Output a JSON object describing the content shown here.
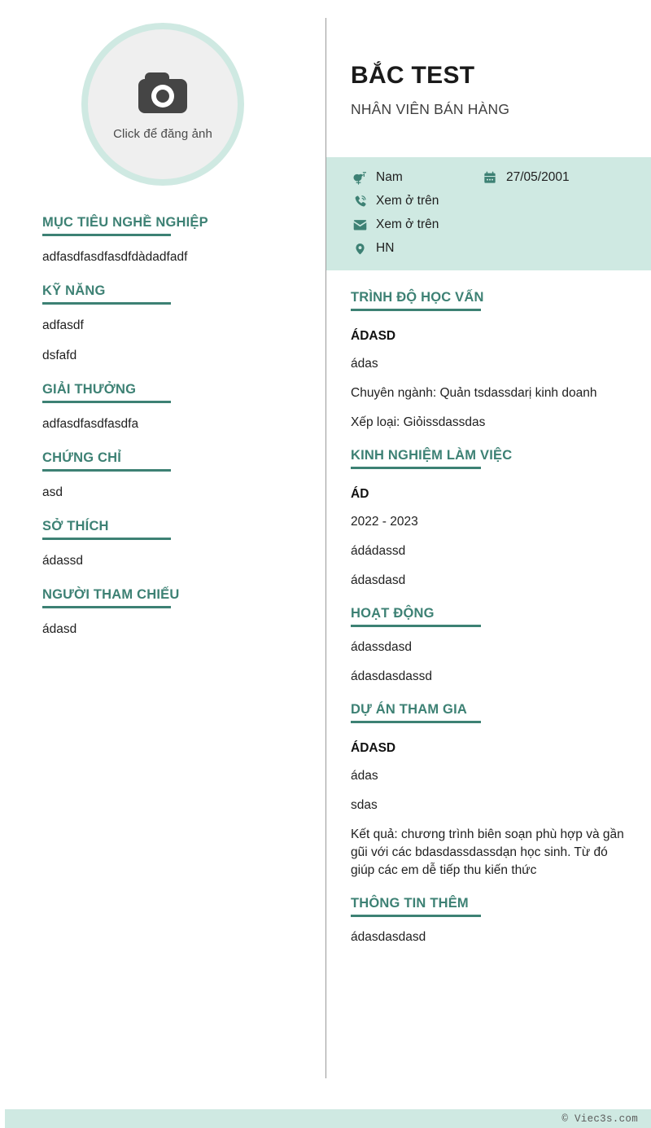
{
  "colors": {
    "accent": "#3d8174",
    "panel_bg": "#cfe9e2",
    "photo_ring": "#cfe9e2",
    "photo_fill": "#efefef",
    "text": "#1f1f1f",
    "divider": "#9a9a9a"
  },
  "photo": {
    "icon": "camera-icon",
    "caption": "Click để đăng ảnh"
  },
  "header": {
    "name": "BẮC TEST",
    "job_title": "NHÂN VIÊN BÁN HÀNG"
  },
  "contact": {
    "gender": {
      "icon": "gender-icon",
      "value": "Nam"
    },
    "birthday": {
      "icon": "calendar-icon",
      "value": "27/05/2001"
    },
    "phone": {
      "icon": "phone-icon",
      "value": "Xem ở trên"
    },
    "email": {
      "icon": "envelope-icon",
      "value": "Xem ở trên"
    },
    "location": {
      "icon": "location-pin-icon",
      "value": "HN"
    }
  },
  "left_sections": [
    {
      "heading": "MỤC TIÊU NGHỀ NGHIỆP",
      "lines": [
        "adfasdfasdfasdfdàdadfadf"
      ]
    },
    {
      "heading": "KỸ NĂNG",
      "lines": [
        "adfasdf",
        "dsfafd"
      ]
    },
    {
      "heading": "GIẢI THƯỞNG",
      "lines": [
        "adfasdfasdfasdfa"
      ]
    },
    {
      "heading": "CHỨNG CHỈ",
      "lines": [
        "asd"
      ]
    },
    {
      "heading": "SỞ THÍCH",
      "lines": [
        "ádassd"
      ]
    },
    {
      "heading": "NGƯỜI THAM CHIẾU",
      "lines": [
        "ádasd"
      ]
    }
  ],
  "right_sections": [
    {
      "heading": "TRÌNH ĐỘ HỌC VẤN",
      "entry_title": "ÁDASD",
      "lines": [
        "ádas",
        "Chuyên ngành: Quản tsdassdarị kinh doanh",
        "Xếp loại: Giỏissdassdas"
      ]
    },
    {
      "heading": "KINH NGHIỆM LÀM VIỆC",
      "entry_title": "ÁD",
      "lines": [
        "2022 - 2023",
        "ádádassd",
        "ádasdasd"
      ]
    },
    {
      "heading": "HOẠT ĐỘNG",
      "entry_title": "",
      "lines": [
        "ádassdasd",
        "ádasdasdassd"
      ]
    },
    {
      "heading": "DỰ ÁN THAM GIA",
      "entry_title": "ÁDASD",
      "lines": [
        "ádas",
        "sdas",
        "Kết quả: chương trình biên soạn phù hợp và gần gũi với các bdasdassdassdạn học sinh. Từ đó giúp các em dễ tiếp thu kiến thức"
      ]
    },
    {
      "heading": "THÔNG TIN THÊM",
      "entry_title": "",
      "lines": [
        "ádasdasdasd"
      ]
    }
  ],
  "footer": {
    "copyright": "© Viec3s.com"
  }
}
